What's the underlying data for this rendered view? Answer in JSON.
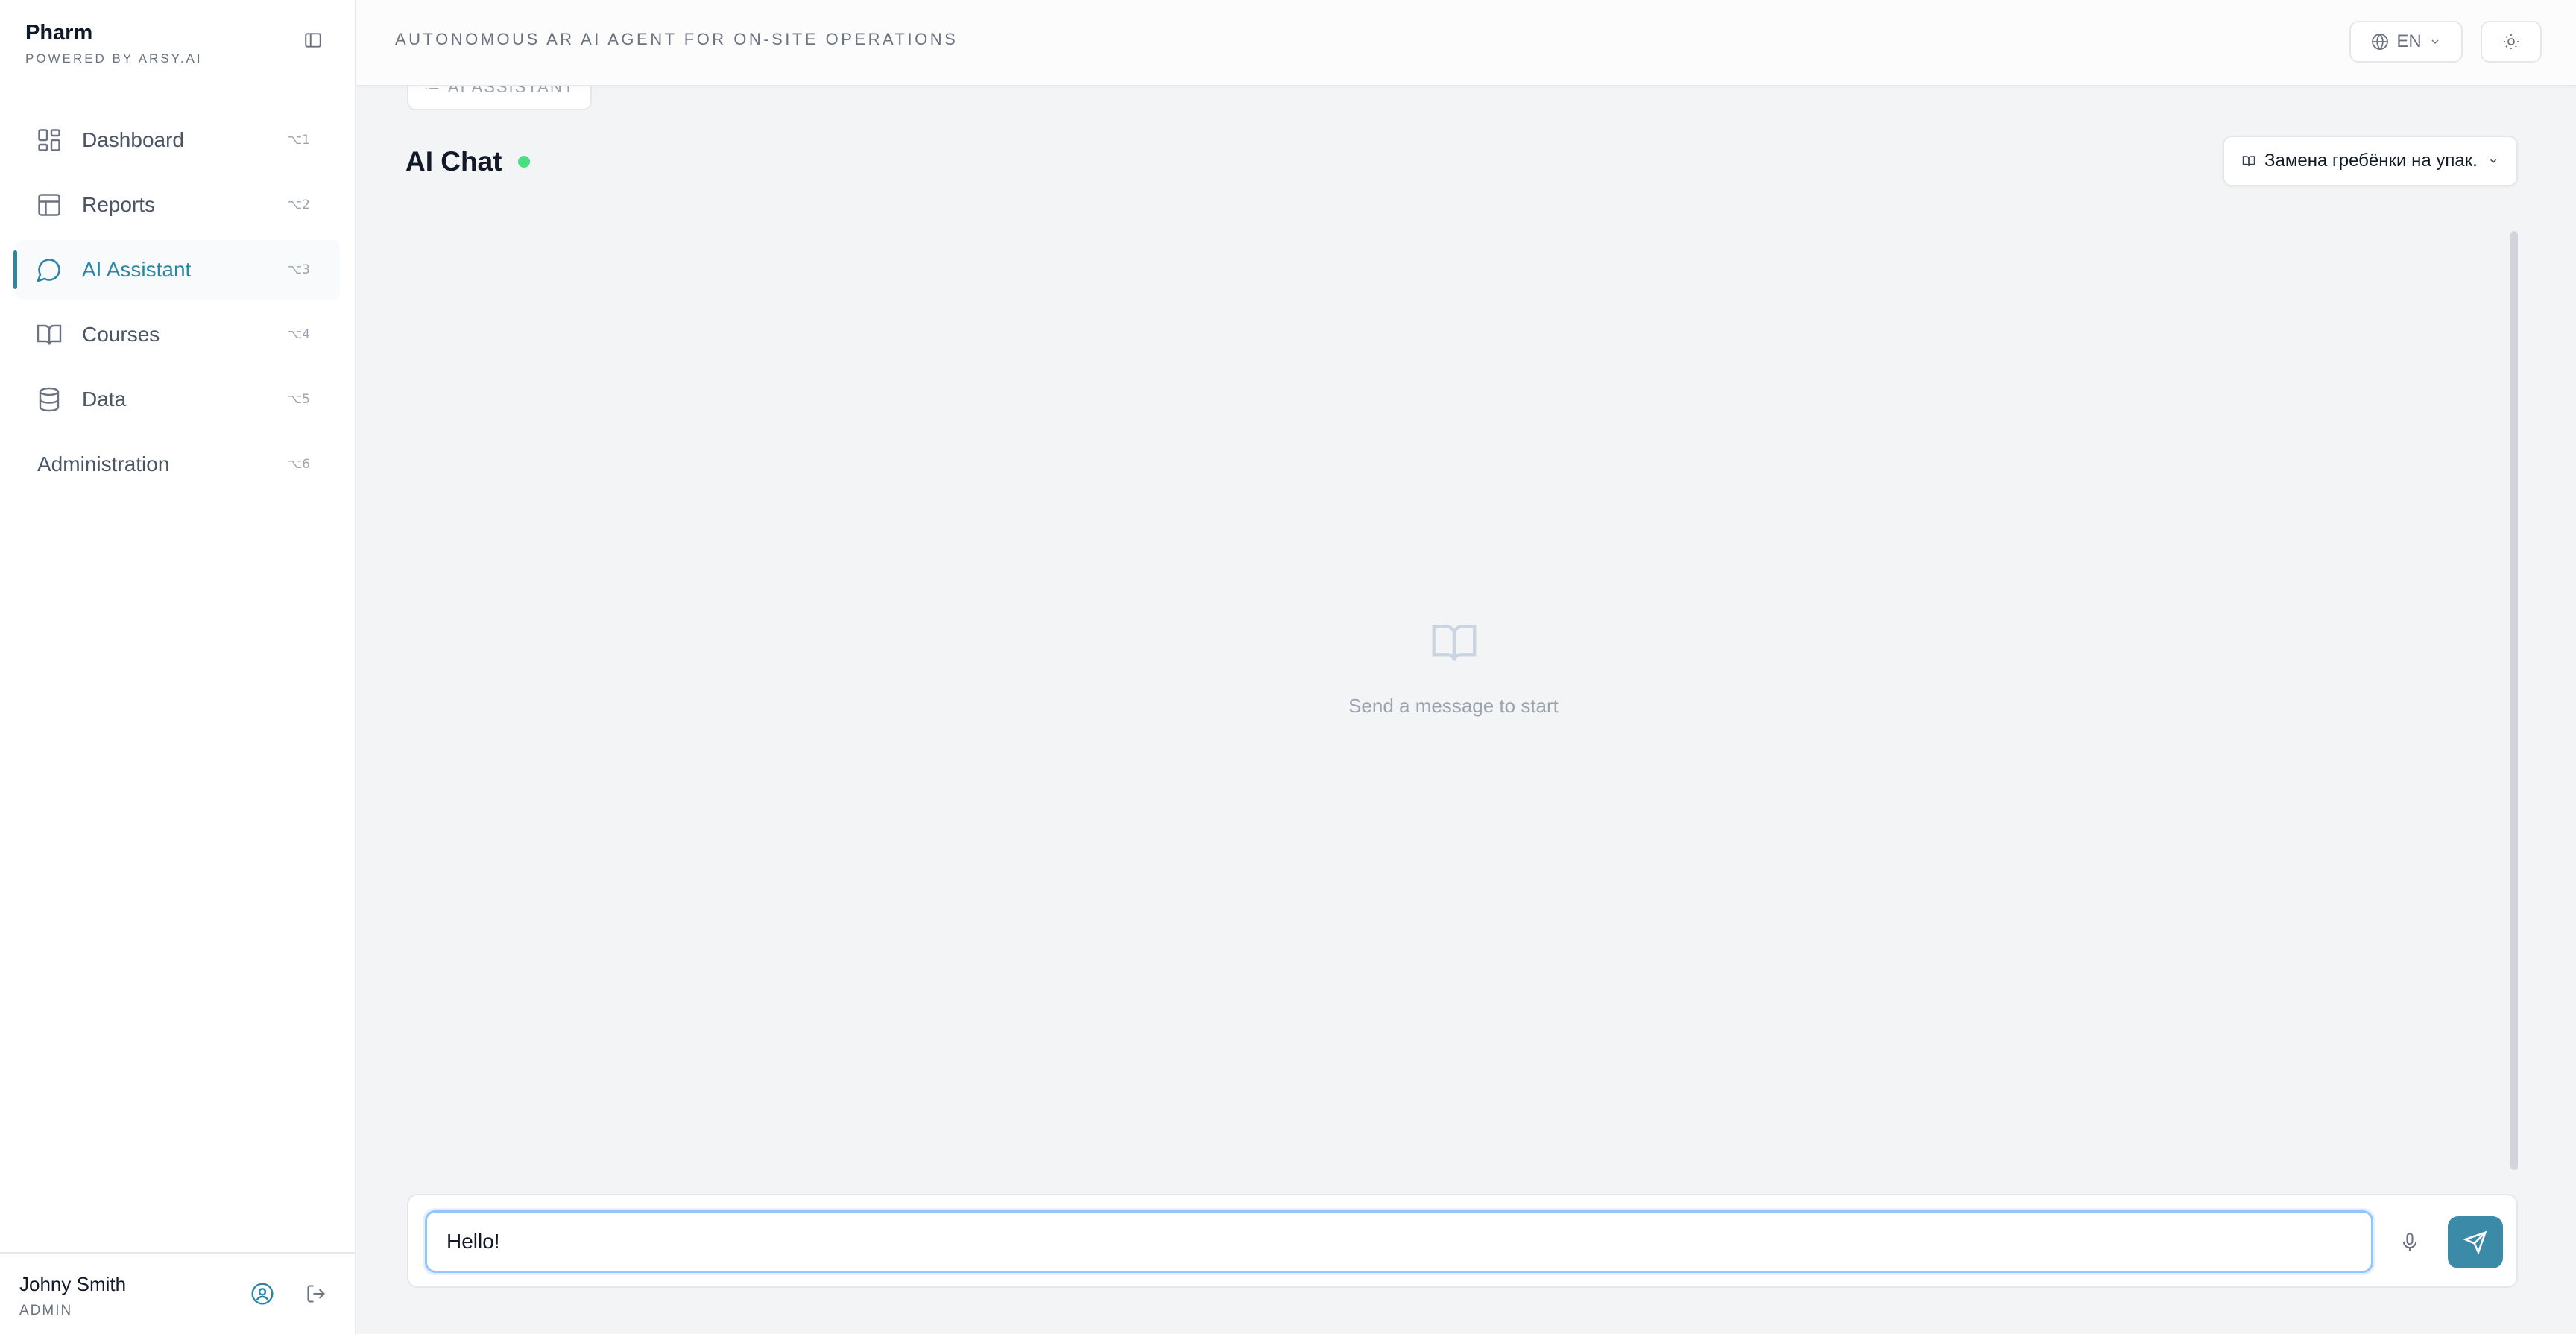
{
  "brand": {
    "name": "Pharm",
    "subtitle": "POWERED BY ARSY.AI"
  },
  "sidebar": {
    "items": [
      {
        "label": "Dashboard",
        "shortcut": "⌥1",
        "icon": "dashboard-icon"
      },
      {
        "label": "Reports",
        "shortcut": "⌥2",
        "icon": "table-icon"
      },
      {
        "label": "AI Assistant",
        "shortcut": "⌥3",
        "icon": "chat-bubble-icon",
        "active": true
      },
      {
        "label": "Courses",
        "shortcut": "⌥4",
        "icon": "book-icon"
      },
      {
        "label": "Data",
        "shortcut": "⌥5",
        "icon": "database-icon"
      },
      {
        "label": "Administration",
        "shortcut": "⌥6"
      }
    ]
  },
  "user": {
    "name": "Johny Smith",
    "role": "ADMIN"
  },
  "topbar": {
    "tagline": "AUTONOMOUS AR AI AGENT FOR ON-SITE OPERATIONS",
    "language": "EN"
  },
  "main": {
    "breadcrumb": "AI ASSISTANT",
    "title": "AI Chat",
    "course_select": "Замена гребёнки на упак...",
    "empty_state": "Send a message to start"
  },
  "composer": {
    "value": "Hello!"
  },
  "colors": {
    "accent": "#2b86a6",
    "send_button": "#3b8aa8",
    "status_online": "#4ade80"
  }
}
